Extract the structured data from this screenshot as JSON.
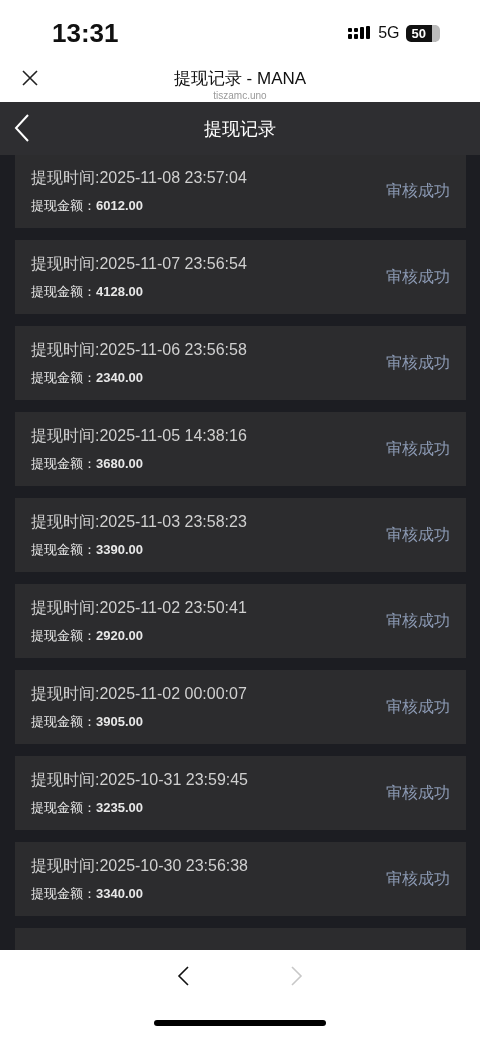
{
  "status_bar": {
    "time": "13:31",
    "network": "5G",
    "battery": "50"
  },
  "browser": {
    "title": "提现记录 - MANA",
    "url": "tiszamc.uno"
  },
  "nav": {
    "title": "提现记录"
  },
  "records": [
    {
      "time": "提现时间:2025-11-08 23:57:04",
      "amount": "提现金额：**6012.00**",
      "status": "审核成功"
    },
    {
      "time": "提现时间:2025-11-07 23:56:54",
      "amount": "提现金额：**4128.00**",
      "status": "审核成功"
    },
    {
      "time": "提现时间:2025-11-06 23:56:58",
      "amount": "提现金额：**2340.00**",
      "status": "审核成功"
    },
    {
      "time": "提现时间:2025-11-05 14:38:16",
      "amount": "提现金额：**3680.00**",
      "status": "审核成功"
    },
    {
      "time": "提现时间:2025-11-03 23:58:23",
      "amount": "提现金额：**3390.00**",
      "status": "审核成功"
    },
    {
      "time": "提现时间:2025-11-02 23:50:41",
      "amount": "提现金额：**2920.00**",
      "status": "审核成功"
    },
    {
      "time": "提现时间:2025-11-02 00:00:07",
      "amount": "提现金额：**3905.00**",
      "status": "审核成功"
    },
    {
      "time": "提现时间:2025-10-31 23:59:45",
      "amount": "提现金额：**3235.00**",
      "status": "审核成功"
    },
    {
      "time": "提现时间:2025-10-30 23:56:38",
      "amount": "提现金额：**3340.00**",
      "status": "审核成功"
    }
  ],
  "toolbar": {
    "back_disabled": false,
    "forward_disabled": true
  }
}
